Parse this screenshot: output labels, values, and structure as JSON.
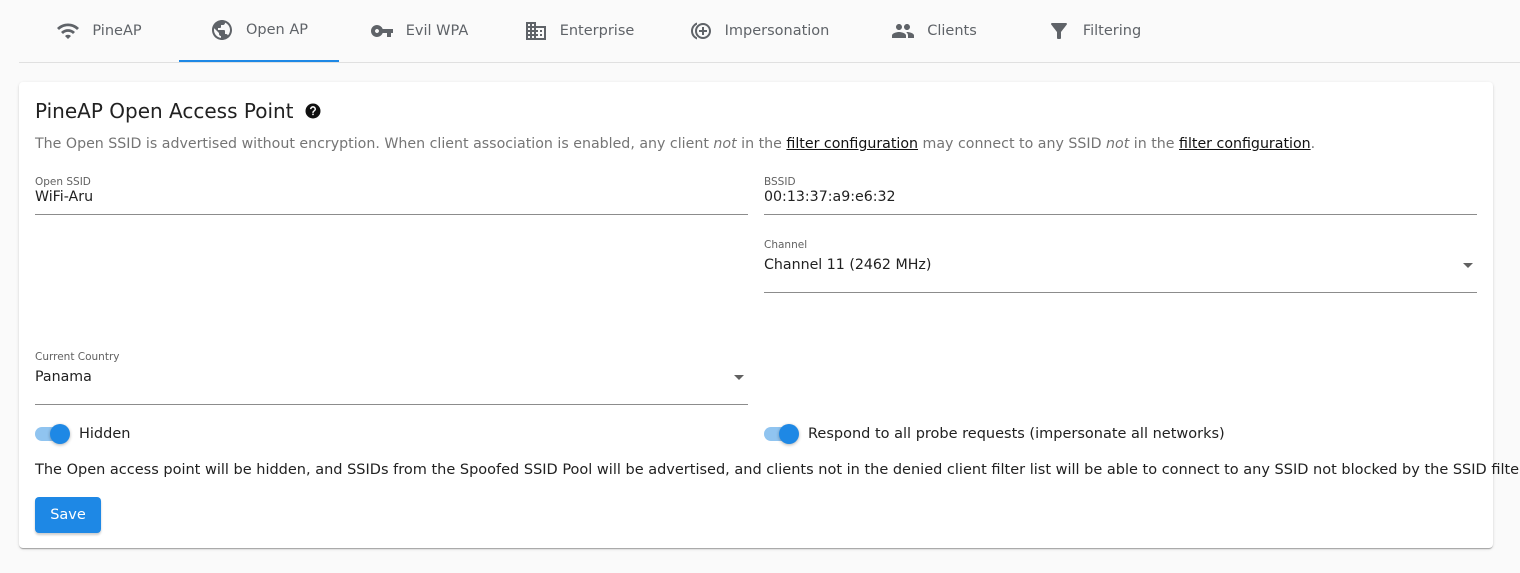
{
  "tabs": [
    {
      "label": "PineAP",
      "icon": "wifi-icon"
    },
    {
      "label": "Open AP",
      "icon": "globe-icon",
      "active": true
    },
    {
      "label": "Evil WPA",
      "icon": "key-icon"
    },
    {
      "label": "Enterprise",
      "icon": "building-icon"
    },
    {
      "label": "Impersonation",
      "icon": "add-circle-icon"
    },
    {
      "label": "Clients",
      "icon": "people-icon"
    },
    {
      "label": "Filtering",
      "icon": "filter-icon"
    }
  ],
  "card": {
    "title": "PineAP Open Access Point",
    "desc_1": "The Open SSID is advertised without encryption. When client association is enabled, any client ",
    "desc_not_1": "not",
    "desc_2": " in the ",
    "desc_link_1": "filter configuration",
    "desc_3": " may connect to any SSID ",
    "desc_not_2": "not",
    "desc_4": " in the ",
    "desc_link_2": "filter configuration",
    "desc_5": "."
  },
  "fields": {
    "open_ssid": {
      "label": "Open SSID",
      "value": "WiFi-Aru"
    },
    "bssid": {
      "label": "BSSID",
      "value": "00:13:37:a9:e6:32"
    },
    "channel": {
      "label": "Channel",
      "value": "Channel 11 (2462 MHz)"
    },
    "country": {
      "label": "Current Country",
      "value": "Panama"
    }
  },
  "toggles": {
    "hidden": {
      "label": "Hidden",
      "on": true
    },
    "respond_all": {
      "label": "Respond to all probe requests (impersonate all networks)",
      "on": true
    }
  },
  "info_text": "The Open access point will be hidden, and SSIDs from the Spoofed SSID Pool will be advertised, and clients not in the denied client filter list will be able to connect to any SSID not blocked by the SSID filter.",
  "save_label": "Save",
  "colors": {
    "accent": "#1e88e5",
    "accent_light": "#90c4f0"
  }
}
